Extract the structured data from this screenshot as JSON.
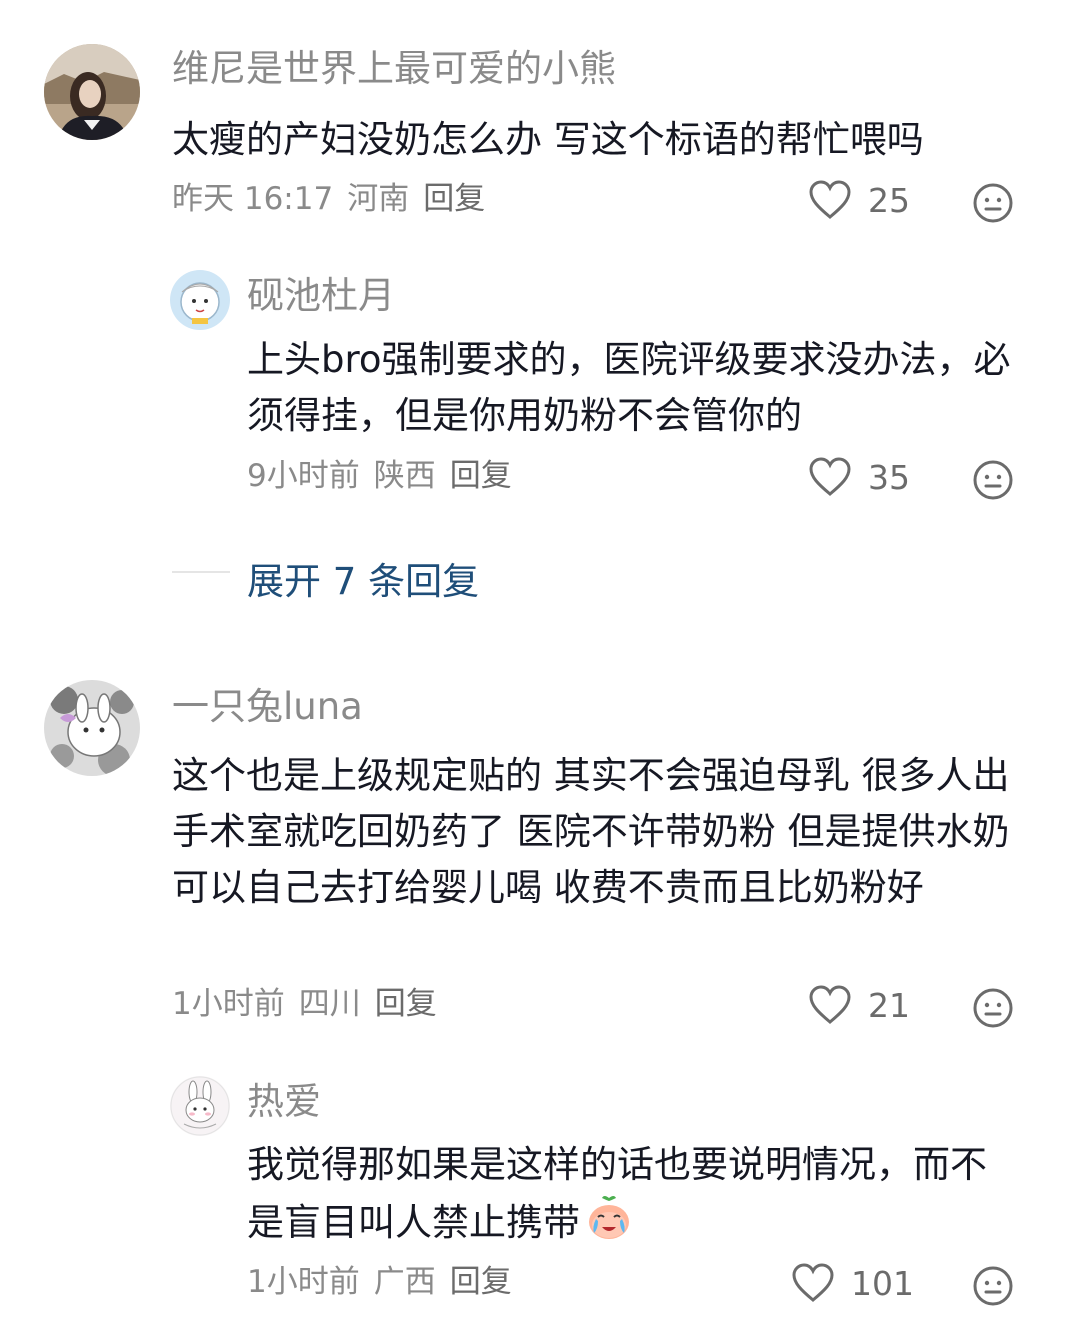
{
  "comments": [
    {
      "user": "维尼是世界上最可爱的小熊",
      "text": "太瘦的产妇没奶怎么办 写这个标语的帮忙喂吗",
      "time": "昨天 16:17",
      "location": "河南",
      "reply_label": "回复",
      "likes": "25",
      "replies": [
        {
          "user": "砚池杜月",
          "text": "上头bro强制要求的，医院评级要求没办法，必须得挂，但是你用奶粉不会管你的",
          "time": "9小时前",
          "location": "陕西",
          "reply_label": "回复",
          "likes": "35"
        }
      ],
      "expand_label": "展开 7 条回复"
    },
    {
      "user": "一只兔luna",
      "text": "这个也是上级规定贴的 其实不会强迫母乳 很多人出手术室就吃回奶药了 医院不许带奶粉 但是提供水奶 可以自己去打给婴儿喝 收费不贵而且比奶粉好",
      "time": "1小时前",
      "location": "四川",
      "reply_label": "回复",
      "likes": "21",
      "replies": [
        {
          "user": "热爱",
          "text": "我觉得那如果是这样的话也要说明情况，而不是盲目叫人禁止携带",
          "time": "1小时前",
          "location": "广西",
          "reply_label": "回复",
          "likes": "101"
        }
      ]
    }
  ],
  "icons": {
    "like": "heart-outline-icon",
    "dislike": "neutral-face-icon",
    "emoji": "crying-peach-emoji"
  },
  "colors": {
    "text": "#161823",
    "meta": "#8a8a8a",
    "expand_link": "#1f4e79"
  }
}
